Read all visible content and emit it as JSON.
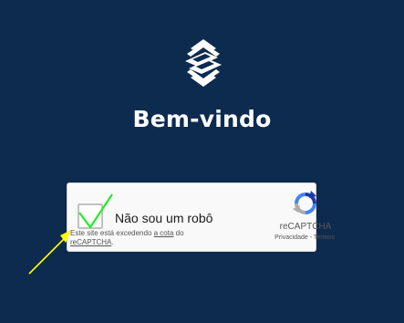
{
  "page": {
    "title": "Bem-vindo",
    "background": "#0d2b4e"
  },
  "logo": {
    "icon": "banco-do-brasil-logo-icon"
  },
  "recaptcha": {
    "checkbox_label": "Não sou um robô",
    "checked": true,
    "quota_text": "Este site está excedendo",
    "quota_link": "a cota",
    "quota_suffix": "do",
    "recaptcha_link": "reCAPTCHA",
    "recaptcha_suffix": ".",
    "brand": "reCAPTCHA",
    "privacy_link": "Privacidade",
    "separator": "-",
    "terms_link": "Termos"
  },
  "annotations": {
    "checkmark_color": "#22ee22",
    "arrow_color": "#ffff00"
  }
}
